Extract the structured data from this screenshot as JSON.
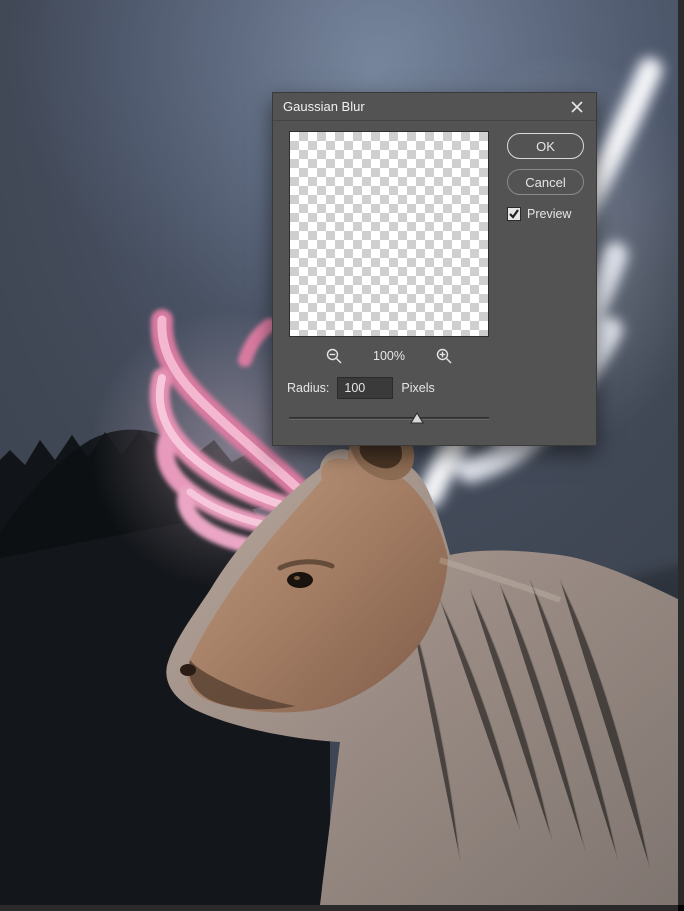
{
  "dialog": {
    "title": "Gaussian Blur",
    "ok_label": "OK",
    "cancel_label": "Cancel",
    "preview_label": "Preview",
    "preview_checked": true,
    "zoom_pct": "100%",
    "radius_label": "Radius:",
    "radius_value": "100",
    "radius_unit": "Pixels",
    "slider_pct": 64
  },
  "icons": {
    "close": "close-icon",
    "zoom_out": "zoom-out-icon",
    "zoom_in": "zoom-in-icon"
  },
  "canvas": {
    "description": "Photo composite of a stag with glowing pink and white antlers against a dusky blue mountain/forest background, edited in Photoshop."
  }
}
